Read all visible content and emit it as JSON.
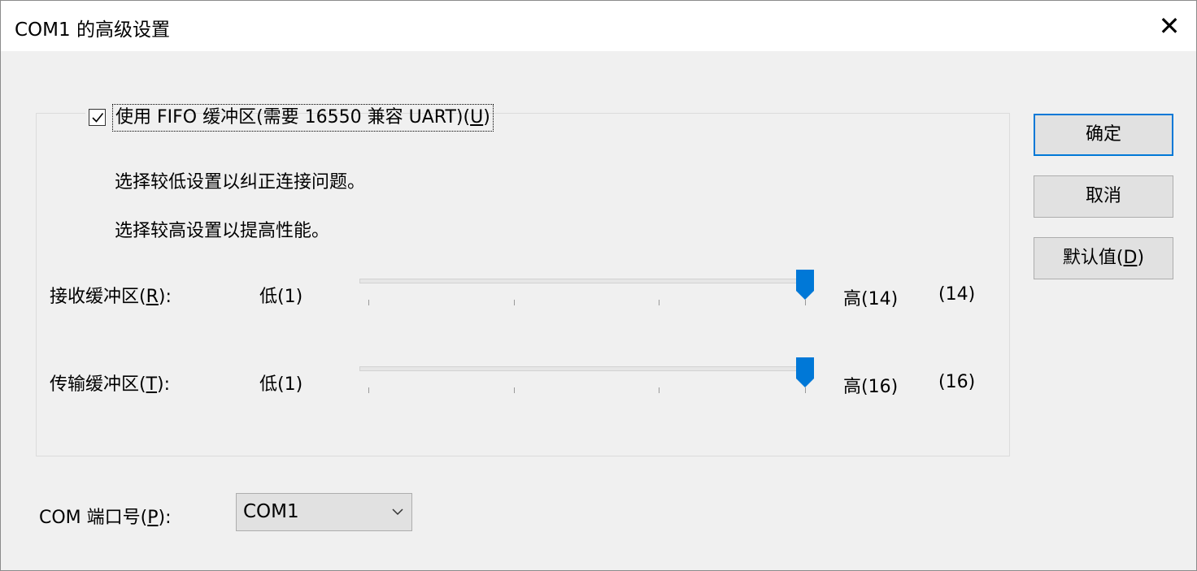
{
  "window": {
    "title": "COM1 的高级设置",
    "close_glyph": "✕"
  },
  "fifo": {
    "label_prefix": "使用 FIFO 缓冲区(需要 16550 兼容 UART)(",
    "label_key": "U",
    "label_suffix": ")",
    "checked": true
  },
  "hints": {
    "low": "选择较低设置以纠正连接问题。",
    "high": "选择较高设置以提高性能。"
  },
  "receive_buffer": {
    "label_prefix": "接收缓冲区(",
    "label_key": "R",
    "label_suffix": "):",
    "min_label": "低(1)",
    "max_label": "高(14)",
    "current_display": "(14)",
    "value": 14,
    "min": 1,
    "max": 14
  },
  "transmit_buffer": {
    "label_prefix": "传输缓冲区(",
    "label_key": "T",
    "label_suffix": "):",
    "min_label": "低(1)",
    "max_label": "高(16)",
    "current_display": "(16)",
    "value": 16,
    "min": 1,
    "max": 16
  },
  "port": {
    "label_prefix": "COM 端口号(",
    "label_key": "P",
    "label_suffix": "):",
    "selected": "COM1"
  },
  "buttons": {
    "ok": "确定",
    "cancel": "取消",
    "defaults_prefix": "默认值(",
    "defaults_key": "D",
    "defaults_suffix": ")"
  },
  "colors": {
    "accent": "#0078d7",
    "background": "#f0f0f0",
    "button_face": "#e1e1e1"
  }
}
